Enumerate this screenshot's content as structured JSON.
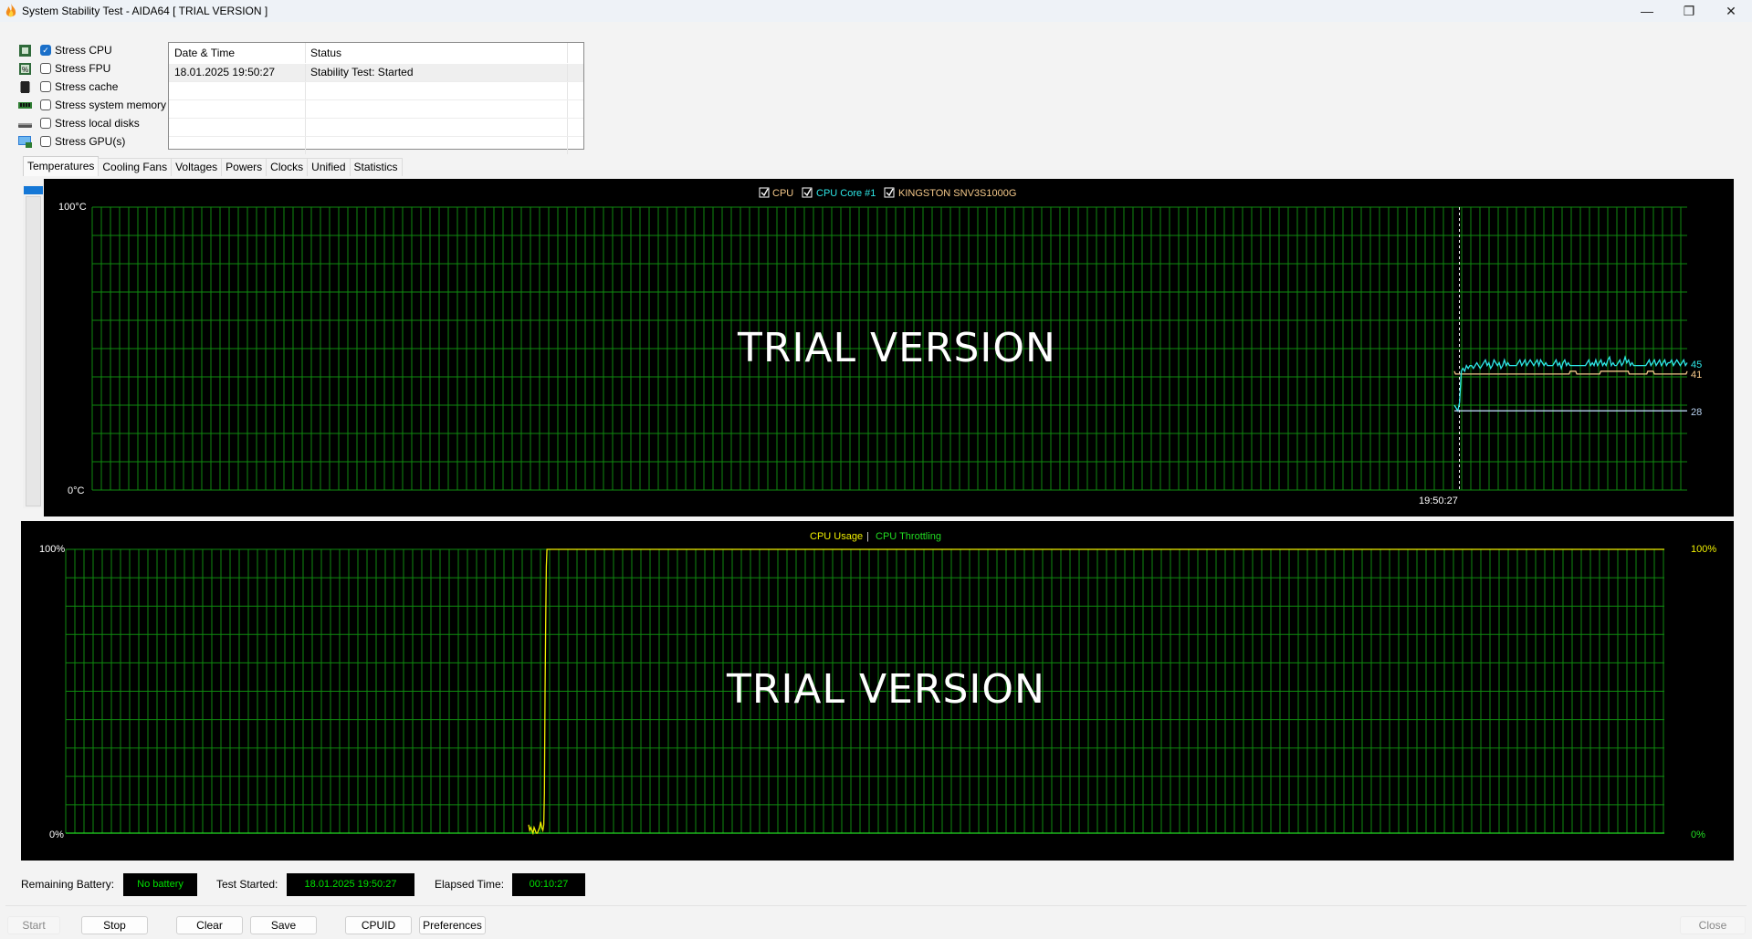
{
  "window": {
    "title": "System Stability Test - AIDA64  [ TRIAL VERSION ]",
    "app_icon": "flame-icon",
    "controls": {
      "minimize": "—",
      "maximize": "❐",
      "close": "✕"
    }
  },
  "stress_options": [
    {
      "label": "Stress CPU",
      "checked": true,
      "icon": "cpu-chip-icon"
    },
    {
      "label": "Stress FPU",
      "checked": false,
      "icon": "fpu-percent-icon"
    },
    {
      "label": "Stress cache",
      "checked": false,
      "icon": "cache-chip-icon"
    },
    {
      "label": "Stress system memory",
      "checked": false,
      "icon": "memory-module-icon"
    },
    {
      "label": "Stress local disks",
      "checked": false,
      "icon": "disk-drive-icon"
    },
    {
      "label": "Stress GPU(s)",
      "checked": false,
      "icon": "gpu-monitor-icon"
    }
  ],
  "log": {
    "columns": [
      "Date & Time",
      "Status"
    ],
    "rows": [
      {
        "datetime": "18.01.2025 19:50:27",
        "status": "Stability Test: Started"
      }
    ],
    "empty_rows": 4
  },
  "tabs": [
    {
      "label": "Temperatures",
      "active": true
    },
    {
      "label": "Cooling Fans",
      "active": false
    },
    {
      "label": "Voltages",
      "active": false
    },
    {
      "label": "Powers",
      "active": false
    },
    {
      "label": "Clocks",
      "active": false
    },
    {
      "label": "Unified",
      "active": false
    },
    {
      "label": "Statistics",
      "active": false
    }
  ],
  "watermark": "TRIAL VERSION",
  "colors": {
    "grid": "#0f8a0f",
    "cpu": "#f5c98a",
    "cpu_core1": "#2ee6e6",
    "kingston": "#b8d2f0",
    "cpu_usage": "#f0f000",
    "cpu_throttling": "#22dd22",
    "status_text": "#00e000"
  },
  "chart_data": [
    {
      "type": "line",
      "title": "Temperatures",
      "ylabel_top": "100°C",
      "ylabel_bottom": "0°C",
      "ylim": [
        0,
        100
      ],
      "grid": true,
      "legend_position": "top-center",
      "x_marker_label": "19:50:27",
      "series": [
        {
          "name": "CPU",
          "checked": true,
          "current": 41,
          "color": "#f5c98a",
          "values": [
            42,
            41,
            41,
            41,
            41,
            41,
            41,
            41,
            41,
            41,
            41,
            41,
            41,
            41,
            41,
            41,
            41,
            41,
            41,
            41,
            41,
            41,
            41,
            41,
            41,
            41,
            41,
            41,
            41,
            41,
            41,
            41,
            41,
            41,
            41,
            41,
            41,
            41,
            41,
            41,
            41,
            41,
            41,
            41,
            41,
            41,
            41,
            41,
            41,
            41,
            41,
            41,
            41,
            41,
            41,
            41,
            41,
            41,
            41,
            41,
            41,
            41,
            41,
            41,
            41,
            41,
            41,
            41,
            41,
            41,
            41,
            41,
            41,
            41,
            41,
            41,
            41,
            41,
            41,
            41,
            41,
            41,
            41,
            41,
            41,
            41,
            41,
            41,
            41,
            41,
            41,
            41,
            41,
            41,
            41,
            41,
            41,
            41,
            41,
            41,
            41,
            41,
            41,
            41,
            41,
            41,
            42,
            42,
            42,
            42,
            42,
            42,
            41,
            41,
            41,
            41,
            41,
            41,
            41,
            41,
            41,
            41,
            41,
            41,
            41,
            41,
            41,
            41,
            41,
            41,
            41,
            41,
            41,
            41,
            42,
            42,
            42,
            42,
            42,
            42,
            42,
            42,
            42,
            42,
            42,
            42,
            42,
            42,
            42,
            42,
            42,
            42,
            42,
            42,
            42,
            42,
            42,
            42,
            42,
            42,
            41,
            41,
            41,
            41,
            41,
            41,
            41,
            41,
            41,
            41,
            41,
            41,
            41,
            41,
            41,
            41,
            41,
            42,
            42,
            42,
            42,
            42,
            42,
            41,
            41,
            41,
            41,
            41,
            41,
            41,
            41,
            41,
            41,
            41,
            41,
            41,
            41,
            41,
            41,
            41,
            41,
            41,
            41,
            41,
            41,
            41,
            41,
            41,
            41,
            41,
            41,
            41,
            41,
            42
          ]
        },
        {
          "name": "CPU Core #1",
          "checked": true,
          "current": 45,
          "color": "#2ee6e6",
          "values": [
            30,
            29,
            28,
            31,
            42,
            43,
            42,
            44,
            43,
            44,
            44,
            43,
            44,
            45,
            44,
            43,
            44,
            45,
            46,
            44,
            45,
            43,
            44,
            46,
            45,
            44,
            45,
            43,
            44,
            46,
            44,
            45,
            44,
            44,
            44,
            44,
            44,
            45,
            46,
            44,
            45,
            46,
            44,
            45,
            46,
            45,
            44,
            45,
            46,
            44,
            46,
            45,
            44,
            45,
            44,
            44,
            44,
            44,
            45,
            46,
            44,
            45,
            43,
            45,
            46,
            44,
            45,
            44,
            44,
            44,
            44,
            44,
            44,
            44,
            44,
            44,
            44,
            45,
            46,
            44,
            45,
            44,
            46,
            44,
            45,
            46,
            44,
            45,
            44,
            46,
            47,
            44,
            45,
            44,
            44,
            45,
            46,
            44,
            45,
            47,
            45,
            46,
            44,
            45,
            44,
            44,
            44,
            44,
            44,
            44,
            44,
            44,
            45,
            46,
            44,
            45,
            46,
            44,
            45,
            46,
            44,
            45,
            46,
            44,
            45,
            45,
            46,
            44,
            45,
            46,
            45,
            44,
            45,
            46,
            44,
            45
          ]
        },
        {
          "name": "KINGSTON SNV3S1000G",
          "checked": true,
          "current": 28,
          "color": "#b8d2f0",
          "values": [
            28,
            28,
            28,
            28,
            28,
            28,
            28,
            28,
            28,
            28,
            28,
            28,
            28,
            28,
            28,
            28,
            28,
            28,
            28,
            28,
            28,
            28,
            28,
            28,
            28,
            28,
            28,
            28,
            28,
            28,
            28,
            28,
            28,
            28,
            28,
            28,
            28,
            28,
            28,
            28,
            28,
            28,
            28,
            28,
            28,
            28,
            28,
            28,
            28,
            28
          ]
        }
      ]
    },
    {
      "type": "line",
      "title": "CPU Usage | CPU Throttling",
      "ylabel_left_top": "100%",
      "ylabel_left_bottom": "0%",
      "ylabel_right_top": "100%",
      "ylabel_right_bottom": "0%",
      "ylim": [
        0,
        100
      ],
      "grid": true,
      "legend_position": "top-center",
      "legend_separator": "|",
      "series": [
        {
          "name": "CPU Usage",
          "color": "#f0f000",
          "pre_values": [
            3,
            1,
            2,
            1,
            0,
            2,
            1,
            0,
            0,
            1,
            2,
            4,
            2,
            1
          ],
          "rise_values": [
            3,
            14,
            50,
            74,
            94,
            100
          ],
          "steady_value": 100
        },
        {
          "name": "CPU Throttling",
          "color": "#22dd22",
          "steady_value": 0
        }
      ]
    }
  ],
  "status": {
    "battery_label": "Remaining Battery:",
    "battery_value": "No battery",
    "test_started_label": "Test Started:",
    "test_started_value": "18.01.2025 19:50:27",
    "elapsed_label": "Elapsed Time:",
    "elapsed_value": "00:10:27"
  },
  "buttons": {
    "start": "Start",
    "stop": "Stop",
    "clear": "Clear",
    "save": "Save",
    "cpuid": "CPUID",
    "preferences": "Preferences",
    "close": "Close"
  }
}
